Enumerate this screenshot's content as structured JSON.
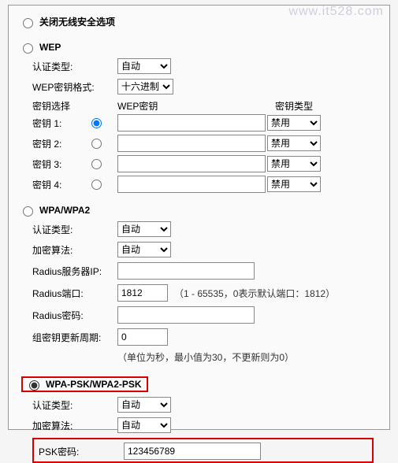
{
  "watermark": "www.it528.com",
  "option_close": "关闭无线安全选项",
  "wep": {
    "title": "WEP",
    "auth_label": "认证类型:",
    "auth_value": "自动",
    "fmt_label": "WEP密钥格式:",
    "fmt_value": "十六进制",
    "hdr_select": "密钥选择",
    "hdr_key": "WEP密钥",
    "hdr_type": "密钥类型",
    "key1_label": "密钥 1:",
    "key2_label": "密钥 2:",
    "key3_label": "密钥 3:",
    "key4_label": "密钥 4:",
    "key1_val": "",
    "key2_val": "",
    "key3_val": "",
    "key4_val": "",
    "type_disabled": "禁用"
  },
  "wpa": {
    "title": "WPA/WPA2",
    "auth_label": "认证类型:",
    "auth_value": "自动",
    "algo_label": "加密算法:",
    "algo_value": "自动",
    "radius_ip_label": "Radius服务器IP:",
    "radius_ip_val": "",
    "radius_port_label": "Radius端口:",
    "radius_port_val": "1812",
    "radius_port_hint": "（1 - 65535，0表示默认端口：1812）",
    "radius_pwd_label": "Radius密码:",
    "radius_pwd_val": "",
    "gkey_label": "组密钥更新周期:",
    "gkey_val": "0",
    "gkey_hint": "（单位为秒，最小值为30，不更新则为0）"
  },
  "psk": {
    "title": "WPA-PSK/WPA2-PSK",
    "auth_label": "认证类型:",
    "auth_value": "自动",
    "algo_label": "加密算法:",
    "algo_value": "自动",
    "pwd_label": "PSK密码:",
    "pwd_val": "123456789"
  }
}
